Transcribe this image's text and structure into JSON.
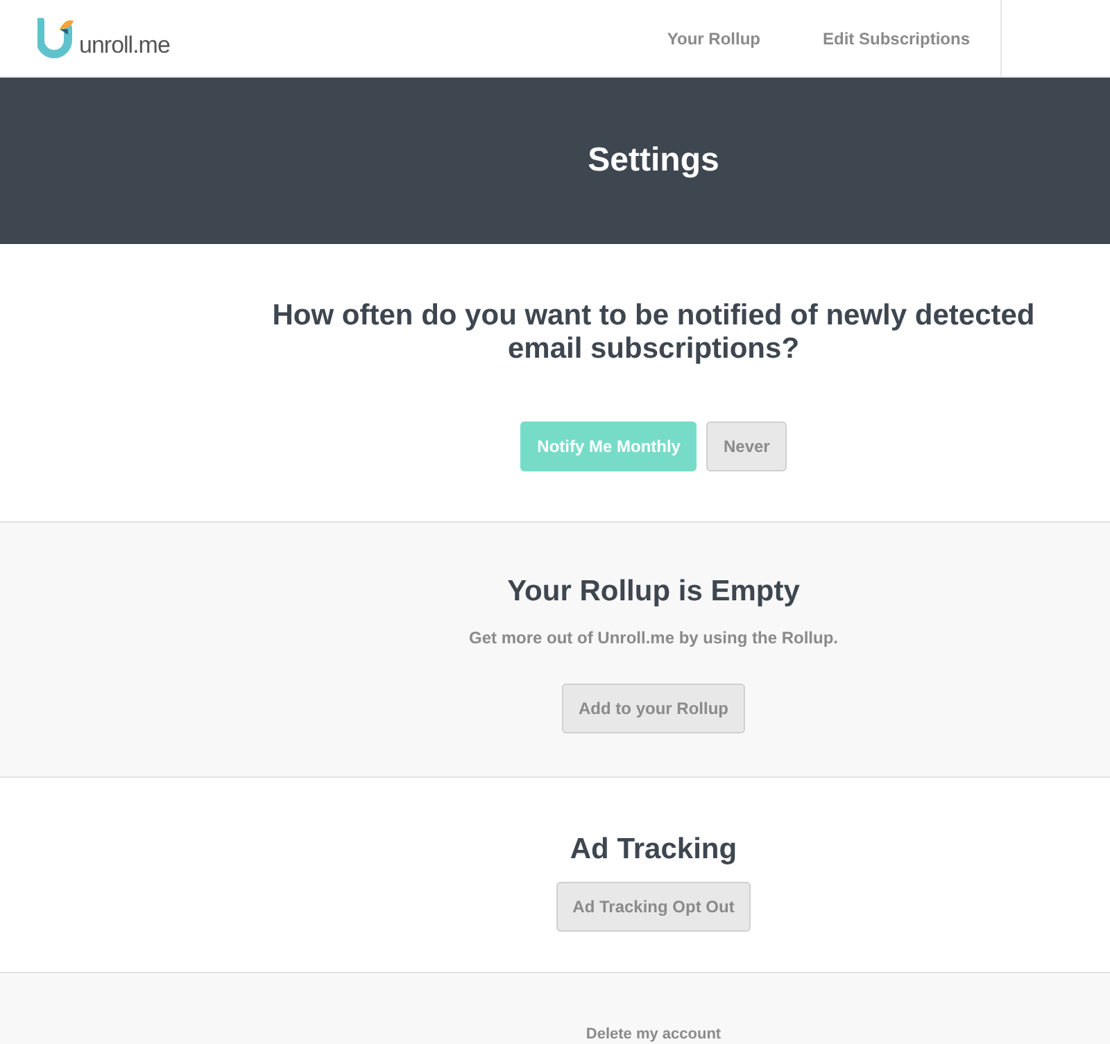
{
  "logo": {
    "text": "unroll.me"
  },
  "nav": [
    {
      "label": "Your Rollup"
    },
    {
      "label": "Edit Subscriptions"
    }
  ],
  "banner": {
    "title": "Settings"
  },
  "notifications": {
    "question": "How often do you want to be notified of newly detected email subscriptions?",
    "options": [
      {
        "label": "Notify Me Monthly",
        "selected": true
      },
      {
        "label": "Never",
        "selected": false
      }
    ]
  },
  "rollup": {
    "title": "Your Rollup is Empty",
    "subtitle": "Get more out of Unroll.me by using the Rollup.",
    "button": "Add to your Rollup"
  },
  "ad_tracking": {
    "title": "Ad Tracking",
    "button": "Ad Tracking Opt Out"
  },
  "delete_link": "Delete my account"
}
